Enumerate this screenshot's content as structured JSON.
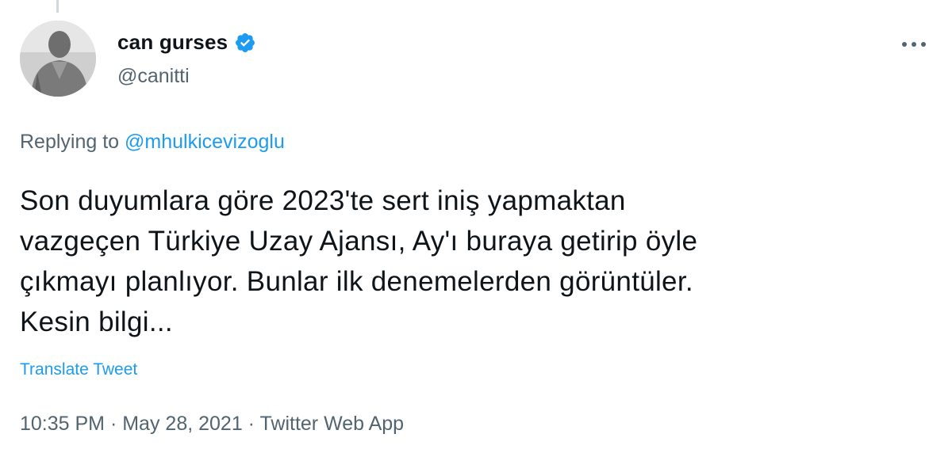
{
  "author": {
    "display_name": "can gurses",
    "handle": "@canitti",
    "verified": true,
    "verified_color": "#1d9bf0",
    "avatar_icon": "user-avatar"
  },
  "menu": {
    "more_icon": "more-horizontal-icon"
  },
  "reply": {
    "prefix": "Replying to ",
    "mention": "@mhulkicevizoglu"
  },
  "tweet": {
    "text": "Son duyumlara göre 2023'te sert iniş yapmaktan\nvazgeçen Türkiye Uzay Ajansı, Ay'ı buraya getirip öyle\nçıkmayı planlıyor. Bunlar ilk denemelerden görüntüler.\nKesin bilgi..."
  },
  "actions": {
    "translate_label": "Translate Tweet"
  },
  "meta": {
    "time": "10:35 PM",
    "separator": " · ",
    "date": "May 28, 2021",
    "source": "Twitter Web App"
  },
  "colors": {
    "accent": "#1d9bf0",
    "text_primary": "#0f1419",
    "text_secondary": "#536471"
  }
}
